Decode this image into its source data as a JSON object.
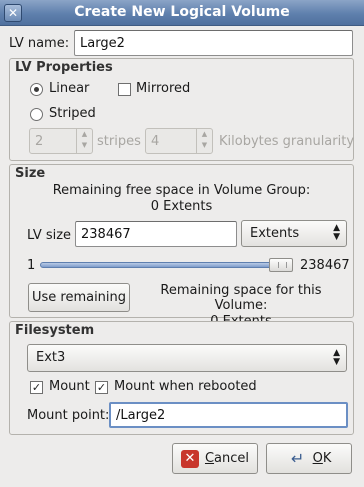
{
  "window": {
    "title": "Create New Logical Volume"
  },
  "lv_name": {
    "label": "LV name:",
    "value": "Large2"
  },
  "properties": {
    "title": "LV Properties",
    "linear_label": "Linear",
    "mirrored_label": "Mirrored",
    "striped_label": "Striped",
    "stripes_value": "2",
    "stripes_label": "stripes",
    "granularity_value": "4",
    "granularity_label": "Kilobytes granularity",
    "selected": "Linear",
    "mirrored_checked": false
  },
  "size": {
    "title": "Size",
    "remaining_vg_line1": "Remaining free space in Volume Group:",
    "remaining_vg_line2": "0 Extents",
    "lv_size_label": "LV size",
    "lv_size_value": "238467",
    "unit_value": "Extents",
    "slider_min": "1",
    "slider_max": "238467",
    "slider_fraction": 1.0,
    "use_remaining_label": "Use remaining",
    "remaining_lv_line1": "Remaining space for this Volume:",
    "remaining_lv_line2": "0 Extents"
  },
  "filesystem": {
    "title": "Filesystem",
    "type_value": "Ext3",
    "mount_label": "Mount",
    "mount_checked": true,
    "mount_reboot_label": "Mount when rebooted",
    "mount_reboot_checked": true,
    "mount_point_label": "Mount point:",
    "mount_point_value": "/Large2"
  },
  "buttons": {
    "cancel_rest": "ancel",
    "cancel_mnemonic": "C",
    "ok_rest": "K",
    "ok_mnemonic": "O"
  }
}
